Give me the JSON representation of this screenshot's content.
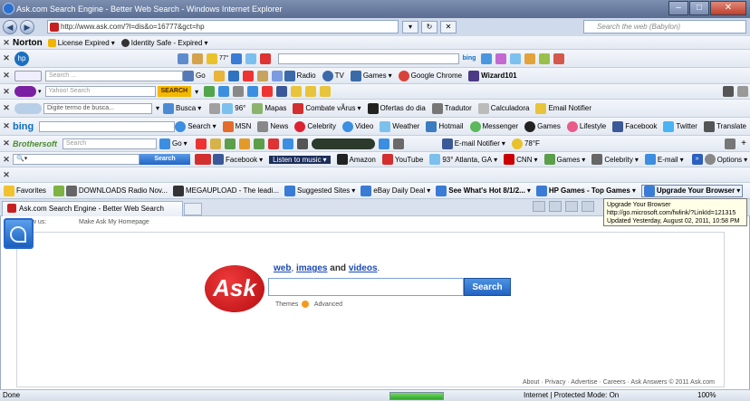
{
  "window": {
    "title": "Ask.com Search Engine - Better Web Search - Windows Internet Explorer"
  },
  "address": {
    "url": "http://www.ask.com/?l=dis&o=16777&gct=hp",
    "search_placeholder": "Search the web (Babylon)"
  },
  "norton": {
    "logo": "Norton",
    "license": "License Expired",
    "identity": "Identity Safe - Expired"
  },
  "hp_bar": {
    "logo": "hp",
    "bing": "bing",
    "temp": "77°"
  },
  "ask_bar": {
    "search_placeholder": "Search ...",
    "go": "Go",
    "radio": "Radio",
    "tv": "TV",
    "games": "Games",
    "chrome": "Google Chrome",
    "wizard": "Wizard101"
  },
  "yahoo_bar": {
    "placeholder": "Yahoo! Search",
    "search": "SEARCH"
  },
  "babylon_bar": {
    "placeholder": "Digite termo de busca...",
    "busca": "Busca",
    "temp": "96°",
    "mapas": "Mapas",
    "combate": "Combate vÃ­rus",
    "ofertas": "Ofertas do dia",
    "tradutor": "Tradutor",
    "calc": "Calculadora",
    "email": "Email Notifier"
  },
  "bing_bar": {
    "logo": "bing",
    "search": "Search",
    "msn": "MSN",
    "news": "News",
    "celebrity": "Celebrity",
    "video": "Video",
    "weather": "Weather",
    "hotmail": "Hotmail",
    "messenger": "Messenger",
    "games": "Games",
    "lifestyle": "Lifestyle",
    "facebook": "Facebook",
    "twitter": "Twitter",
    "translate": "Translate"
  },
  "brothers_bar": {
    "logo": "Brothersoft",
    "placeholder": "Search",
    "go": "Go",
    "email": "E-mail Notifier",
    "temp": "78°F"
  },
  "ask_toolbar": {
    "search": "Search",
    "facebook": "Facebook",
    "listen": "Listen to music",
    "amazon": "Amazon",
    "youtube": "YouTube",
    "weather": "93° Atlanta, GA",
    "cnn": "CNN",
    "games": "Games",
    "celebrity": "Celebrity",
    "email": "E-mail",
    "options": "Options"
  },
  "favorites": {
    "label": "Favorites",
    "items": [
      "DOWNLOADS Radio Nov...",
      "MEGAUPLOAD - The leadi...",
      "Suggested Sites",
      "eBay Daily Deal",
      "See What's Hot 8/1/2...",
      "HP Games - Top Games",
      "Upgrade Your Browser"
    ]
  },
  "tab": {
    "title": "Ask.com Search Engine - Better Web Search"
  },
  "tooltip": {
    "line1": "Upgrade Your Browser",
    "line2": "http://go.microsoft.com/fwlink/?LinkId=121315",
    "line3": "Updated Yesterday, August 02, 2011, 10:58 PM"
  },
  "page": {
    "follow": "ow us:",
    "homepage": "Make Ask My Homepage",
    "logo": "Ask",
    "tag_web": "web",
    "tag_images": "images",
    "tag_and": "and",
    "tag_videos": "videos",
    "search_btn": "Search",
    "themes": "Themes",
    "advanced": "Advanced",
    "footer": "About · Privacy · Advertise · Careers · Ask Answers   © 2011 Ask.com"
  },
  "status": {
    "text": "Done",
    "progress": 1.0,
    "zone": "Internet | Protected Mode: On",
    "zoom": "100%"
  }
}
